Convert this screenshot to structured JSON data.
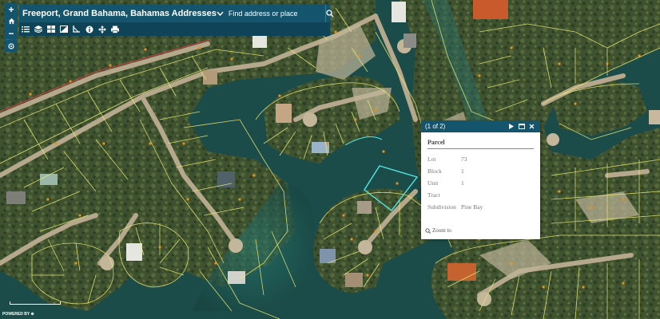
{
  "app": {
    "title": "Freeport, Grand Bahama, Bahamas Addresses"
  },
  "search": {
    "placeholder": "Find address or place"
  },
  "toolbar": {
    "icons": [
      "list-icon",
      "layers-icon",
      "basemap-icon",
      "legend-icon",
      "measure-icon",
      "about-icon",
      "move-icon",
      "print-icon"
    ]
  },
  "zoom": {
    "in_label": "+",
    "out_label": "−"
  },
  "popup": {
    "pager": "(1 of 2)",
    "title": "Parcel",
    "fields": [
      {
        "label": "Lot",
        "value": "73"
      },
      {
        "label": "Block",
        "value": "1"
      },
      {
        "label": "Unit",
        "value": "1"
      },
      {
        "label": "Tract",
        "value": ""
      },
      {
        "label": "Subdivision",
        "value": "Pine Bay"
      }
    ],
    "zoom_to": "Zoom to"
  },
  "footer": {
    "powered_by": "POWERED BY ⊕"
  },
  "colors": {
    "header": "#14546c",
    "toolbar": "#0f4458",
    "parcel_line": "#e8e870",
    "selected_parcel": "#4fe6e6",
    "water": "#1e5a55",
    "land": "#4a5a34",
    "road": "#b9aa8e"
  }
}
